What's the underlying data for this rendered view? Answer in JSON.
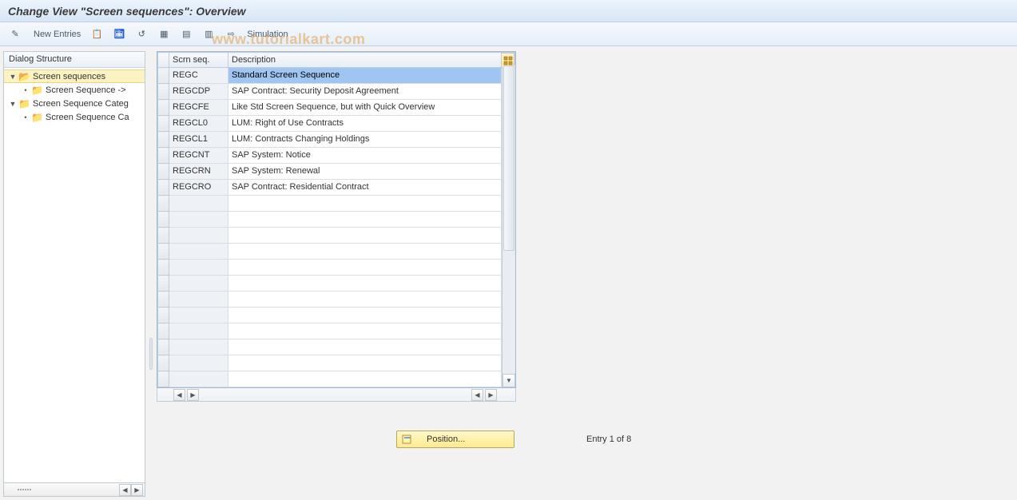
{
  "window": {
    "title": "Change View \"Screen sequences\": Overview"
  },
  "toolbar": {
    "new_entries": "New Entries",
    "simulation": "Simulation"
  },
  "watermark": "www.tutorialkart.com",
  "tree": {
    "header": "Dialog Structure",
    "nodes": {
      "screen_sequences": "Screen sequences",
      "screen_sequence_sub": "Screen Sequence ->",
      "screen_sequence_categ": "Screen Sequence Categ",
      "screen_sequence_ca": "Screen Sequence Ca"
    }
  },
  "table": {
    "columns": {
      "scrn_seq": "Scrn seq.",
      "description": "Description"
    },
    "rows": [
      {
        "seq": "REGC",
        "desc": "Standard Screen Sequence",
        "selected": true
      },
      {
        "seq": "REGCDP",
        "desc": "SAP Contract: Security Deposit Agreement"
      },
      {
        "seq": "REGCFE",
        "desc": "Like Std Screen Sequence, but with Quick Overview"
      },
      {
        "seq": "REGCL0",
        "desc": "LUM: Right of Use Contracts"
      },
      {
        "seq": "REGCL1",
        "desc": "LUM: Contracts Changing Holdings"
      },
      {
        "seq": "REGCNT",
        "desc": "SAP System: Notice"
      },
      {
        "seq": "REGCRN",
        "desc": "SAP System: Renewal"
      },
      {
        "seq": "REGCRO",
        "desc": "SAP Contract: Residential Contract"
      }
    ],
    "empty_rows": 12
  },
  "footer": {
    "position_label": "Position...",
    "entry_text": "Entry 1 of 8"
  }
}
